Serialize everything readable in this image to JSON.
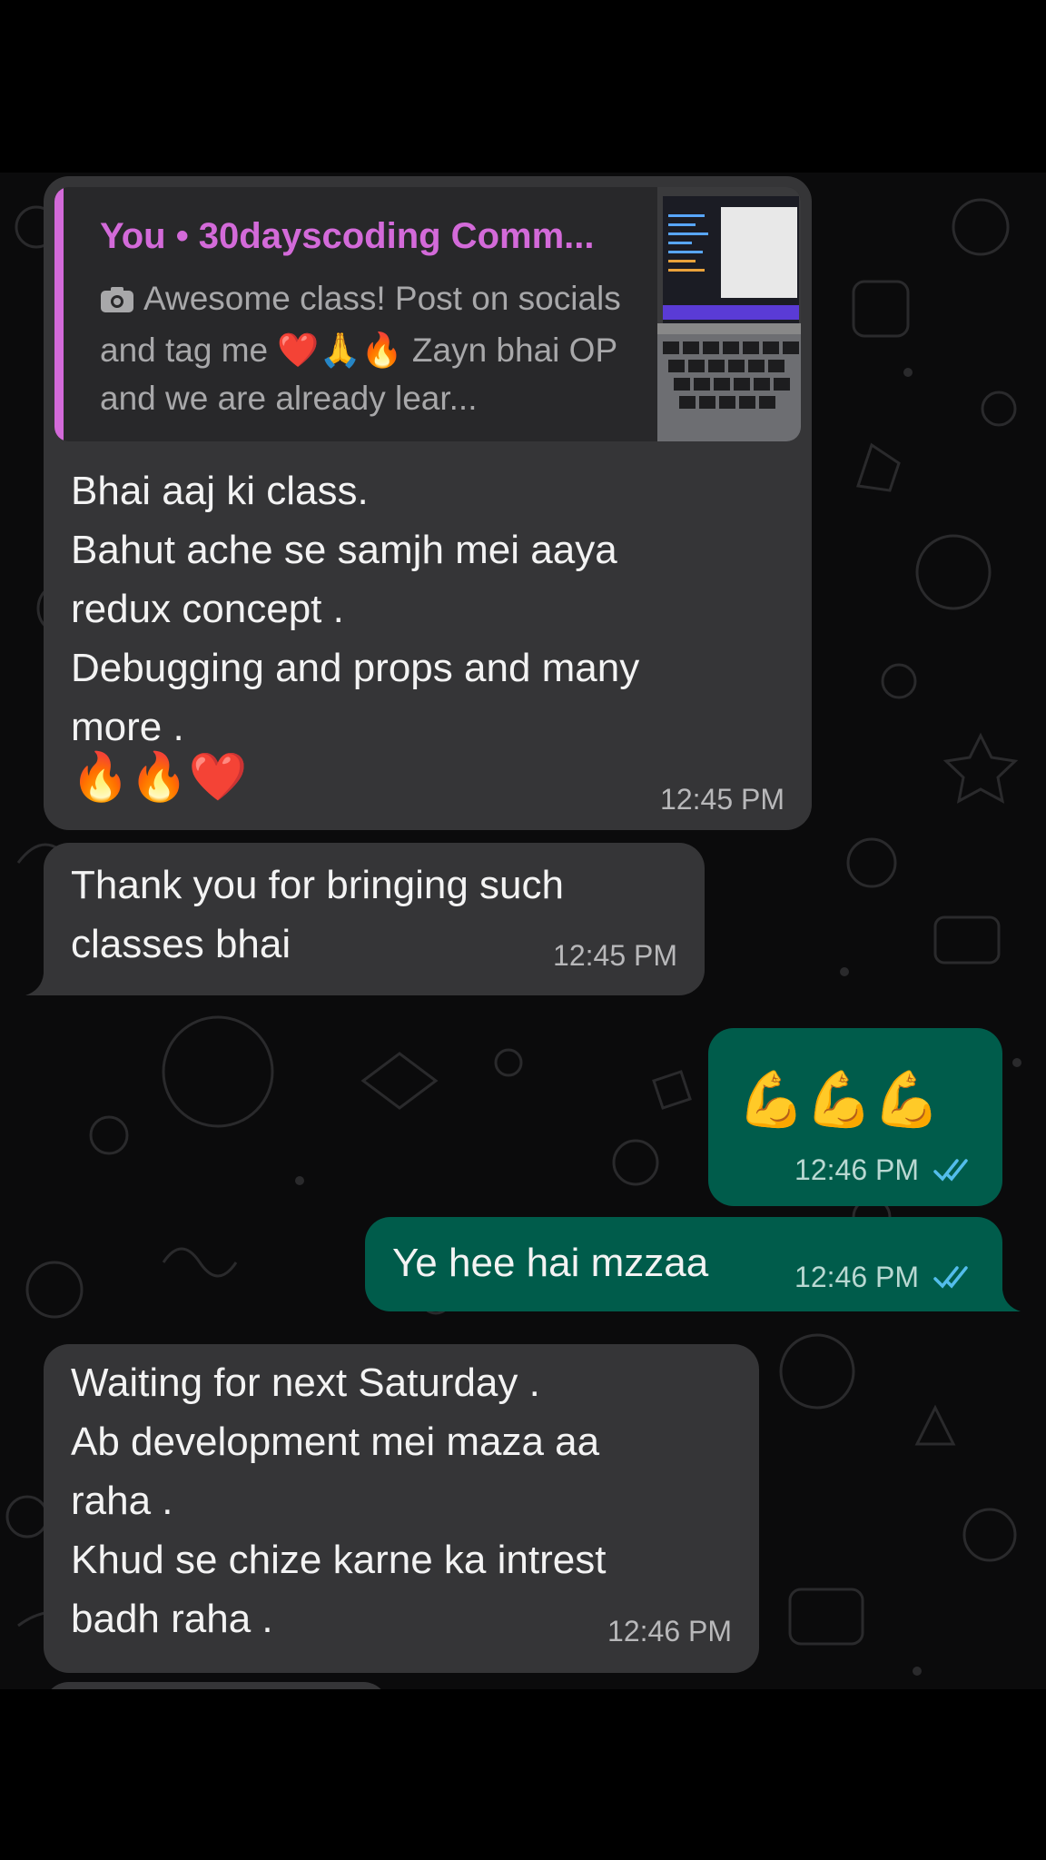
{
  "quoted": {
    "author": "You • 30dayscoding Comm...",
    "text": "Awesome class! Post on socials and tag me ❤️🙏🔥 Zayn bhai OP and we are already lear...",
    "camera_icon": "camera-icon",
    "thumbnail_icon": "laptop-photo-thumbnail"
  },
  "messages": [
    {
      "id": "m1",
      "direction": "incoming",
      "text": "Bhai aaj ki class.\nBahut ache se samjh mei aaya\nredux concept .\nDebugging and props and many\nmore .",
      "emoji": "🔥🔥❤️",
      "time": "12:45 PM"
    },
    {
      "id": "m2",
      "direction": "incoming",
      "text": "Thank you for bringing such\nclasses bhai",
      "time": "12:45 PM"
    },
    {
      "id": "m3",
      "direction": "outgoing",
      "emoji": "💪💪💪",
      "time": "12:46 PM",
      "status": "read"
    },
    {
      "id": "m4",
      "direction": "outgoing",
      "text": "Ye hee hai mzzaa",
      "time": "12:46 PM",
      "status": "read"
    },
    {
      "id": "m5",
      "direction": "incoming",
      "text": "Waiting for next Saturday .\nAb development mei maza aa\nraha .\nKhud se chize karne ka intrest\nbadh raha .",
      "time": "12:46 PM"
    }
  ],
  "colors": {
    "incoming_bubble": "#353537",
    "outgoing_bubble": "#005c4b",
    "quote_accent": "#d36ad9",
    "read_ticks": "#53bdeb"
  }
}
